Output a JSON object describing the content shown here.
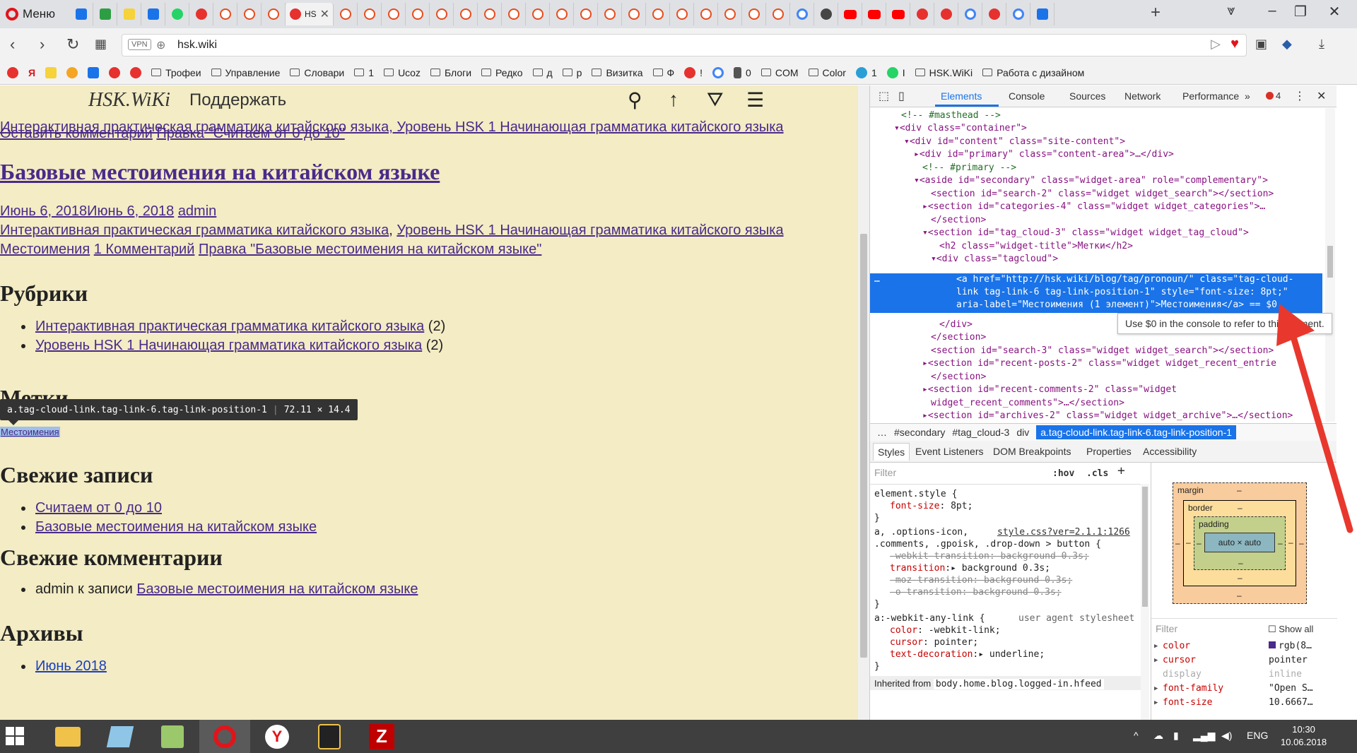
{
  "browser": {
    "menu_label": "Меню",
    "active_tab_label": "HS",
    "url": "hsk.wiki",
    "vpn_label": "VPN"
  },
  "bookmarks": [
    {
      "label": "Трофеи"
    },
    {
      "label": "Управление"
    },
    {
      "label": "Словари"
    },
    {
      "label": "1"
    },
    {
      "label": "Ucoz"
    },
    {
      "label": "Блоги"
    },
    {
      "label": "Редко"
    },
    {
      "label": "д"
    },
    {
      "label": "р"
    },
    {
      "label": "Визитка"
    },
    {
      "label": "Ф"
    },
    {
      "label": "!"
    },
    {
      "label": "0"
    },
    {
      "label": "COM"
    },
    {
      "label": "Color"
    },
    {
      "label": "1"
    },
    {
      "label": "I"
    },
    {
      "label": "HSK.WiKi"
    },
    {
      "label": "Работа с дизайном"
    }
  ],
  "site": {
    "logo": "HSK.WiKi",
    "support": "Поддержать",
    "line1": "Интерактивная практическая грамматика китайского языка, Уровень HSK 1 Начинающая грамматика китайского языка",
    "prev_comment": "Оставить комментарий",
    "prev_edit": "Правка \"Считаем от 0 до 10\"",
    "post_title": "Базовые местоимения на китайском языке",
    "post_date": "Июнь 6, 2018Июнь 6, 2018",
    "post_author": "admin",
    "post_cat1": "Интерактивная практическая грамматика китайского языка",
    "post_cat_sep": ", ",
    "post_cat2": "Уровень HSK 1 Начинающая грамматика китайского языка",
    "post_tag": "Местоимения",
    "post_comments": "1 Комментарий",
    "post_edit": "Правка \"Базовые местоимения на китайском языке\"",
    "rubrics_title": "Рубрики",
    "rubrics": [
      {
        "label": "Интерактивная практическая грамматика китайского языка",
        "count": " (2)"
      },
      {
        "label": "Уровень HSK 1 Начинающая грамматика китайского языка",
        "count": " (2)"
      }
    ],
    "tags_title": "Метки",
    "tag_link": "Местоимения",
    "tooltip_selector": "a.tag-cloud-link.tag-link-6.tag-link-position-1",
    "tooltip_size": "72.11 × 14.4",
    "recent_title": "Свежие записи",
    "recent": [
      "Считаем от 0 до 10",
      "Базовые местоимения на китайском языке"
    ],
    "comments_title": "Свежие комментарии",
    "comment_author": "admin к записи ",
    "comment_link": "Базовые местоимения на китайском языке",
    "archives_title": "Архивы",
    "archive_link": "Июнь 2018"
  },
  "devtools": {
    "tabs": [
      "Elements",
      "Console",
      "Sources",
      "Network",
      "Performance"
    ],
    "more": "»",
    "error_count": "4",
    "dom_lines": [
      "<!-- #masthead -->",
      "<div class=\"container\">",
      "<div id=\"content\" class=\"site-content\">",
      "<div id=\"primary\" class=\"content-area\">…</div>",
      "<!-- #primary -->",
      "<aside id=\"secondary\" class=\"widget-area\" role=\"complementary\">",
      "<section id=\"search-2\" class=\"widget widget_search\"></section>",
      "<section id=\"categories-4\" class=\"widget widget_categories\">…",
      "</section>",
      "<section id=\"tag_cloud-3\" class=\"widget widget_tag_cloud\">",
      "<h2 class=\"widget-title\">Метки</h2>",
      "<div class=\"tagcloud\">",
      "</div>",
      "</section>",
      "<section id=\"search-3\" class=\"widget widget_search\"></section>",
      "<section id=\"recent-posts-2\" class=\"widget widget_recent_entrie",
      "</section>",
      "<section id=\"recent-comments-2\" class=\"widget",
      "widget_recent_comments\">…</section>",
      "<section id=\"archives-2\" class=\"widget widget_archive\">…</section>"
    ],
    "selected_line1_prefix": "<a href=\"",
    "selected_href": "http://hsk.wiki/blog/tag/pronoun/",
    "selected_line1_suffix": "\" class=\"tag-cloud-",
    "selected_line2": "link tag-link-6 tag-link-position-1\" style=\"font-size: 8pt;\"",
    "selected_line3": "aria-label=\"Местоимения (1 элемент)\">Местоимения</a> == $0",
    "selected_dots": "…",
    "console_tip": "Use $0 in the console to refer to this element.",
    "breadcrumbs": [
      "…",
      "#secondary",
      "#tag_cloud-3",
      "div",
      "a.tag-cloud-link.tag-link-6.tag-link-position-1"
    ],
    "styles_tabs": [
      "Styles",
      "Event Listeners",
      "DOM Breakpoints",
      "Properties",
      "Accessibility"
    ],
    "filter_placeholder": "Filter",
    "hov": ":hov",
    "cls": ".cls",
    "plus": "+",
    "rules": {
      "element_style": "element.style {",
      "es_prop": "font-size",
      "es_val": "8pt;",
      "close": "}",
      "rule2_sel1": "a, .options-icon,",
      "rule2_src": "style.css?ver=2.1.1:1266",
      "rule2_sel2": ".comments, .gpoisk, .drop-down > button {",
      "r2_p1": "-webkit-transition: background 0.3s;",
      "r2_p2n": "transition",
      "r2_p2v": "background 0.3s;",
      "r2_p3": "-moz-transition: background 0.3s;",
      "r2_p4": "-o-transition: background 0.3s;",
      "rule3_sel": "a:-webkit-any-link {",
      "rule3_src": "user agent stylesheet",
      "r3_p1n": "color",
      "r3_p1v": "-webkit-link;",
      "r3_p2n": "cursor",
      "r3_p2v": "pointer;",
      "r3_p3n": "text-decoration",
      "r3_p3v": "underline;",
      "inherited_label": "Inherited from ",
      "inherited_sel": "body.home.blog.logged-in.hfeed"
    },
    "box": {
      "margin": "margin",
      "border": "border",
      "padding": "padding",
      "content": "auto × auto",
      "dash": "–"
    },
    "computed_filter": "Filter",
    "show_all": "Show all",
    "computed": [
      {
        "name": "color",
        "value": "rgb(8…",
        "dim": false
      },
      {
        "name": "cursor",
        "value": "pointer",
        "dim": false
      },
      {
        "name": "display",
        "value": "inline",
        "dim": true
      },
      {
        "name": "font-family",
        "value": "\"Open S…",
        "dim": false
      },
      {
        "name": "font-size",
        "value": "10.6667…",
        "dim": false
      }
    ]
  },
  "taskbar": {
    "lang": "ENG",
    "time": "10:30",
    "date": "10.06.2018"
  }
}
